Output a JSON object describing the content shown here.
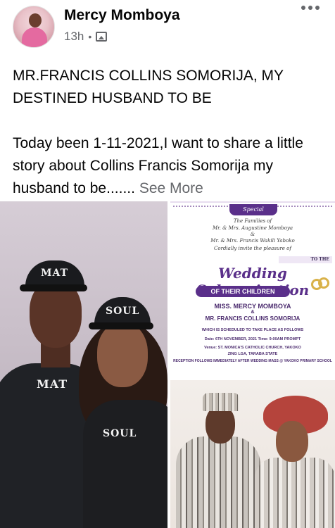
{
  "post": {
    "author": "Mercy Momboya",
    "time": "13h",
    "separator": "•",
    "audience_icon": "photo-icon",
    "paragraph1": "MR.FRANCIS COLLINS SOMORIJA, MY DESTINED HUSBAND TO BE",
    "paragraph2": "Today been 1-11-2021,I want to share a little story about Collins Francis Somorija my husband to be.......",
    "see_more": "See More"
  },
  "photos": {
    "left": {
      "cap1": "MAT",
      "shirt1": "MAT",
      "cap2": "SOUL",
      "shirt2": "SOUL"
    },
    "invitation": {
      "banner": "Special Invitation",
      "families": "The Families of",
      "family1": "Mr. & Mrs. Augustine Momboya",
      "amp": "&",
      "family2": "Mr. & Mrs. Francis Wakili Yaboko",
      "cordially": "Cordially invite the pleasure of",
      "to_the": "TO THE",
      "title": "Wedding Solemnization",
      "of_their": "OF THEIR CHILDREN",
      "bride": "MISS. MERCY MOMBOYA",
      "and": "&",
      "groom": "MR. FRANCIS COLLINS SOMORIJA",
      "scheduled": "WHICH IS SCHEDULED TO TAKE PLACE AS FOLLOWS",
      "date": "Date:  6TH NOVEMBER, 2021  Time: 9:00AM PROMPT",
      "venue": "Venue: ST. MONICA'S CATHOLIC CHURCH, YAKOKO",
      "venue2": "ZING LGA, TARABA STATE",
      "reception": "RECEPTION FOLLOWS IMMEDIATELY AFTER WEDDING MASS @ YAKOKO PRIMARY SCHOOL"
    }
  },
  "colors": {
    "name": "#050505",
    "secondary": "#65676b",
    "invite_purple": "#5a2f8a"
  }
}
